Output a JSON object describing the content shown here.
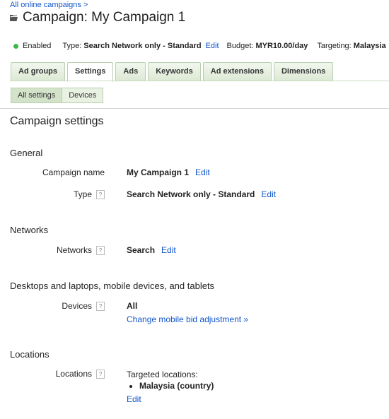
{
  "breadcrumb": "All online campaigns >",
  "title": "Campaign: My Campaign 1",
  "status": {
    "enabled": "Enabled",
    "type_label": "Type:",
    "type_value": "Search Network only - Standard",
    "type_edit": "Edit",
    "budget_label": "Budget:",
    "budget_value": "MYR10.00/day",
    "targeting_label": "Targeting:",
    "targeting_value": "Malaysia"
  },
  "tabs": [
    "Ad groups",
    "Settings",
    "Ads",
    "Keywords",
    "Ad extensions",
    "Dimensions"
  ],
  "subtabs": [
    "All settings",
    "Devices"
  ],
  "main_title": "Campaign settings",
  "general": {
    "heading": "General",
    "campaign_name_label": "Campaign name",
    "campaign_name_value": "My Campaign 1",
    "campaign_name_edit": "Edit",
    "type_label": "Type",
    "type_value": "Search Network only - Standard",
    "type_edit": "Edit"
  },
  "networks": {
    "heading": "Networks",
    "label": "Networks",
    "value": "Search",
    "edit": "Edit"
  },
  "devices": {
    "heading": "Desktops and laptops, mobile devices, and tablets",
    "label": "Devices",
    "value": "All",
    "link": "Change mobile bid adjustment »"
  },
  "locations": {
    "heading": "Locations",
    "label": "Locations",
    "targeted": "Targeted locations:",
    "item": "Malaysia (country)",
    "edit": "Edit"
  },
  "help_mark": "?",
  "colors": {
    "enabled_dot": "#3cb944",
    "link": "#1155cc",
    "tab_bg": "#dce9d4"
  },
  "icons": {
    "title": "folder-icon",
    "enabled": "status-dot-icon"
  }
}
